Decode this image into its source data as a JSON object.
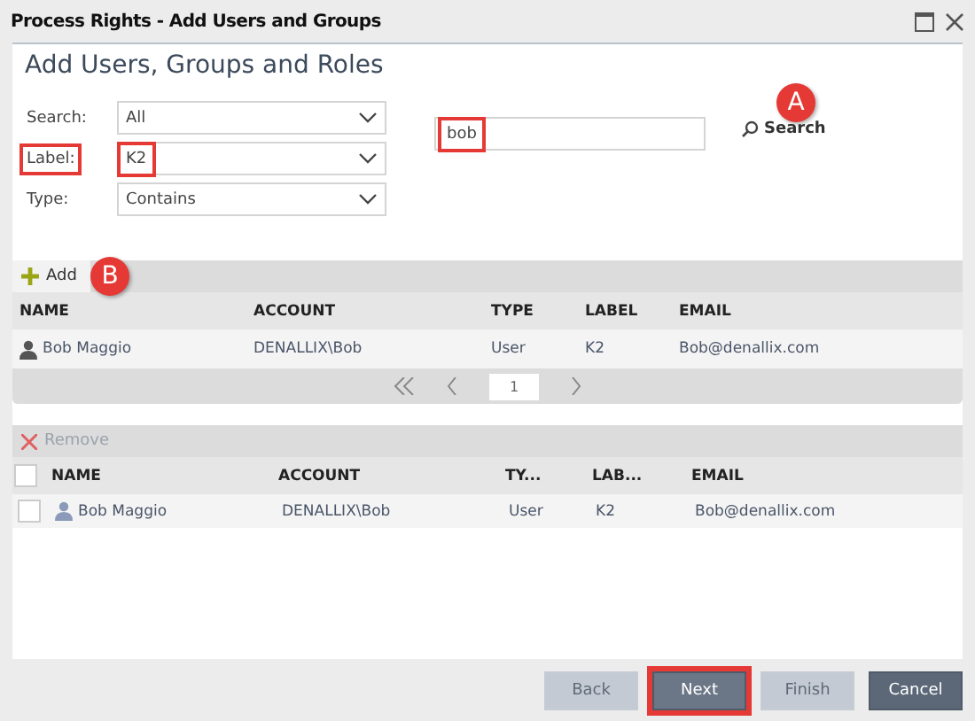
{
  "window": {
    "title": "Process Rights - Add Users and Groups"
  },
  "heading": "Add Users, Groups and Roles",
  "filters": [
    {
      "label": "Search:",
      "value": "All",
      "highlighted": false
    },
    {
      "label": "Label:",
      "value": "K2",
      "highlighted": true
    },
    {
      "label": "Type:",
      "value": "Contains",
      "highlighted": false
    }
  ],
  "search_field": {
    "value": "bob",
    "highlighted": true
  },
  "search_button": {
    "label": "Search",
    "callout": "A"
  },
  "results": {
    "toolbar": {
      "label": "Add",
      "callout": "B"
    },
    "columns": [
      "NAME",
      "ACCOUNT",
      "TYPE",
      "LABEL",
      "EMAIL"
    ],
    "rows": [
      {
        "name": "Bob Maggio",
        "account": "DENALLIX\\Bob",
        "type": "User",
        "label": "K2",
        "email": "Bob@denallix.com"
      }
    ],
    "pager": {
      "page": "1"
    }
  },
  "selected": {
    "toolbar": {
      "label": "Remove",
      "disabled": true
    },
    "select_all": {
      "checked": false
    },
    "columns": [
      "NAME",
      "ACCOUNT",
      "TY...",
      "LAB...",
      "EMAIL"
    ],
    "rows": [
      {
        "checked": false,
        "name": "Bob Maggio",
        "account": "DENALLIX\\Bob",
        "type": "User",
        "label": "K2",
        "email": "Bob@denallix.com"
      }
    ]
  },
  "buttons": [
    {
      "label": "Back",
      "disabled": true,
      "highlighted": false
    },
    {
      "label": "Next",
      "disabled": false,
      "highlighted": true
    },
    {
      "label": "Finish",
      "disabled": true,
      "highlighted": false
    },
    {
      "label": "Cancel",
      "disabled": false,
      "highlighted": false
    }
  ]
}
